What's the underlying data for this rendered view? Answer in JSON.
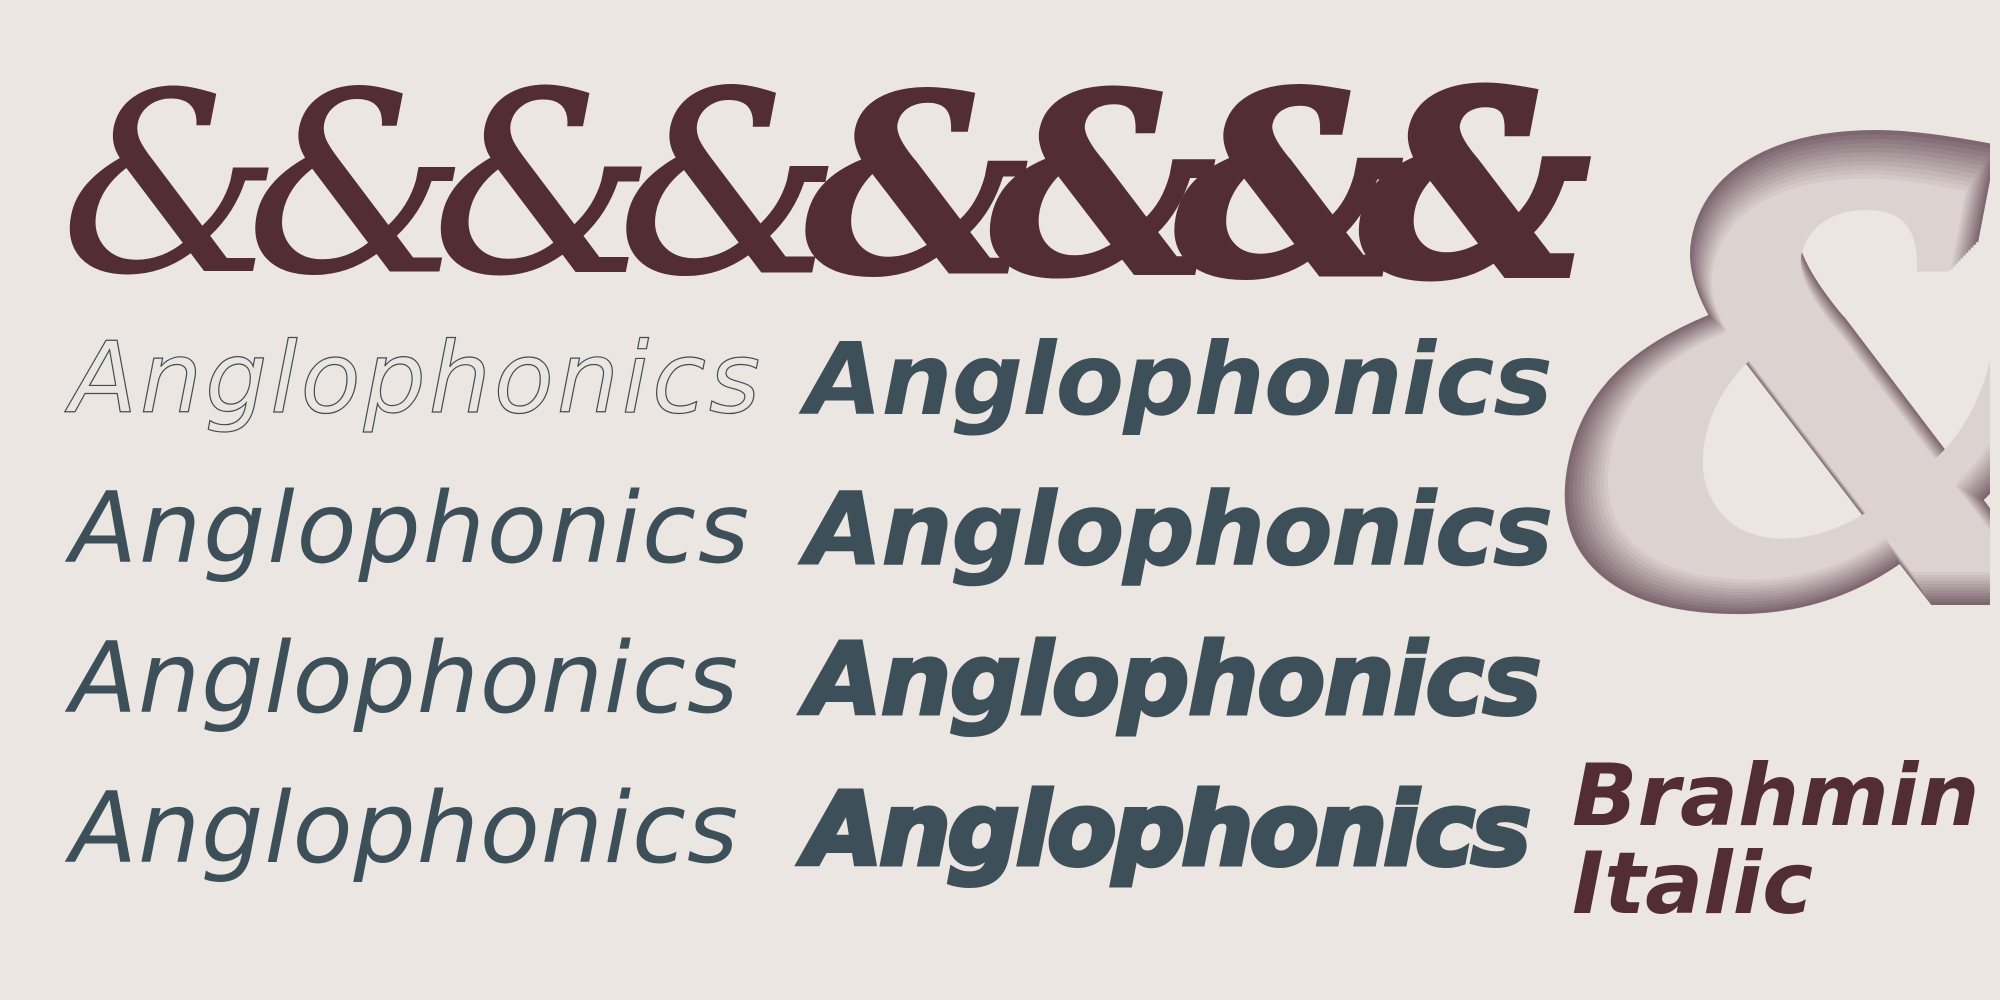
{
  "ampersand_glyph": "&",
  "specimen_word": "Anglophonics",
  "ampersand_weights": [
    100,
    200,
    300,
    400,
    500,
    600,
    700,
    800
  ],
  "specimen_rows": [
    {
      "light_weight": 100,
      "bold_weight": 500
    },
    {
      "light_weight": 200,
      "bold_weight": 600
    },
    {
      "light_weight": 300,
      "bold_weight": 700
    },
    {
      "light_weight": 400,
      "bold_weight": 800
    }
  ],
  "font_name": {
    "line1": "Brahmin",
    "line2": "Italic"
  },
  "colors": {
    "background": "#ece6e2",
    "ampersand": "#522d33",
    "specimen_text": "#3d4f58",
    "big_ampersand_dark": "#7e6770",
    "big_ampersand_light": "#dcd3d1"
  }
}
